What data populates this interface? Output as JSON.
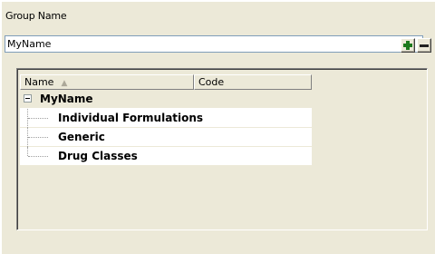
{
  "group": {
    "label": "Group Name",
    "value": "MyName",
    "add_icon": "plus-icon",
    "remove_icon": "minus-icon"
  },
  "tree": {
    "columns": [
      {
        "label": "Name",
        "sort_icon": "sort-ascending-icon"
      },
      {
        "label": "Code"
      }
    ],
    "root": {
      "label": "MyName",
      "expanded": true,
      "children": [
        {
          "label": "Individual Formulations"
        },
        {
          "label": "Generic"
        },
        {
          "label": "Drug Classes"
        }
      ]
    }
  },
  "colors": {
    "window_bg": "#ece9d8",
    "add_green": "#1d7a1d"
  }
}
